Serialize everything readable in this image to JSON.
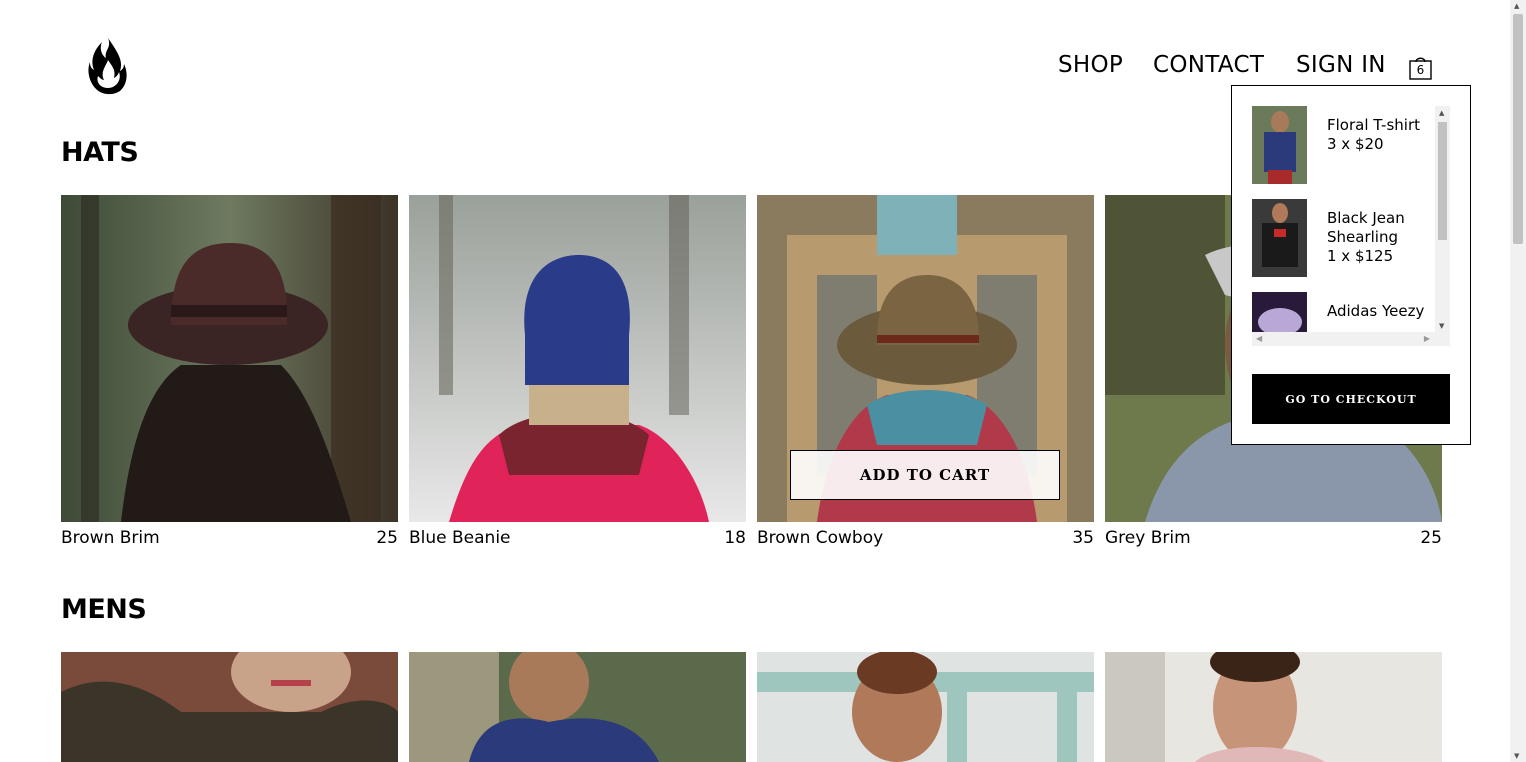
{
  "nav": {
    "shop": "SHOP",
    "contact": "CONTACT",
    "sign_in": "SIGN IN",
    "cart_count": "6"
  },
  "sections": {
    "hats": {
      "title": "HATS",
      "items": [
        {
          "name": "Brown Brim",
          "price": "25"
        },
        {
          "name": "Blue Beanie",
          "price": "18"
        },
        {
          "name": "Brown Cowboy",
          "price": "35"
        },
        {
          "name": "Grey Brim",
          "price": "25"
        }
      ],
      "add_to_cart": "ADD TO CART"
    },
    "mens": {
      "title": "MENS"
    }
  },
  "cart": {
    "items": [
      {
        "name": "Floral T-shirt",
        "qty": "3 x $20"
      },
      {
        "name": "Black Jean Shearling",
        "qty": "1 x $125"
      },
      {
        "name": "Adidas Yeezy",
        "qty": ""
      }
    ],
    "checkout": "GO TO CHECKOUT"
  },
  "icons": {
    "logo": "flame-logo-icon",
    "cart": "shopping-bag-icon"
  }
}
